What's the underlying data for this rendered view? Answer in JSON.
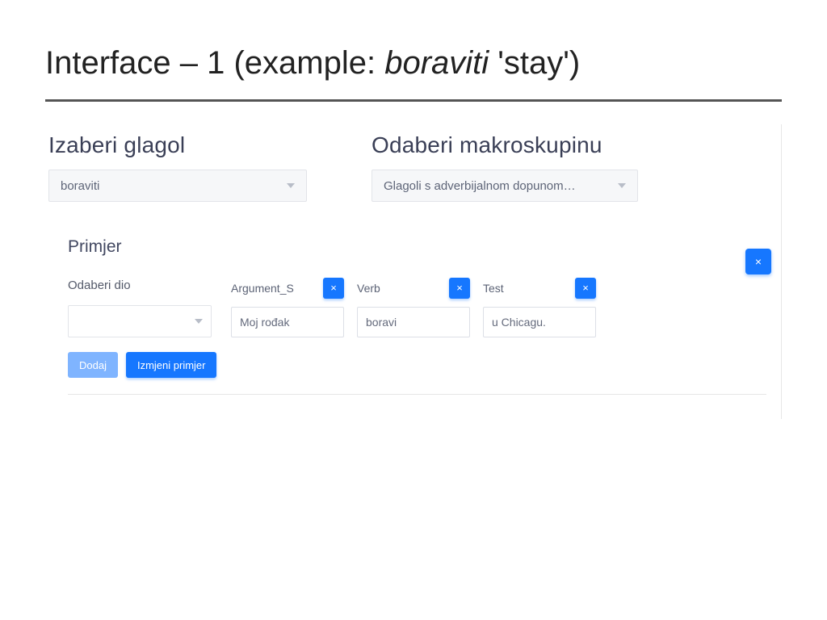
{
  "slide": {
    "title_pre": "Interface – 1 (example: ",
    "title_italic": "boraviti",
    "title_post": " 'stay')"
  },
  "verb_section": {
    "heading": "Izaberi glagol",
    "selected": "boraviti"
  },
  "macro_section": {
    "heading": "Odaberi makroskupinu",
    "selected": "Glagoli s adverbijalnom dopunom…"
  },
  "example": {
    "heading": "Primjer",
    "odaberi_label": "Odaberi dio",
    "part_selected": "",
    "pieces": [
      {
        "label": "Argument_S",
        "value": "Moj rođak"
      },
      {
        "label": "Verb",
        "value": "boravi"
      },
      {
        "label": "Test",
        "value": "u Chicagu."
      }
    ],
    "btn_add": "Dodaj",
    "btn_edit": "Izmjeni primjer",
    "close_glyph": "×"
  }
}
